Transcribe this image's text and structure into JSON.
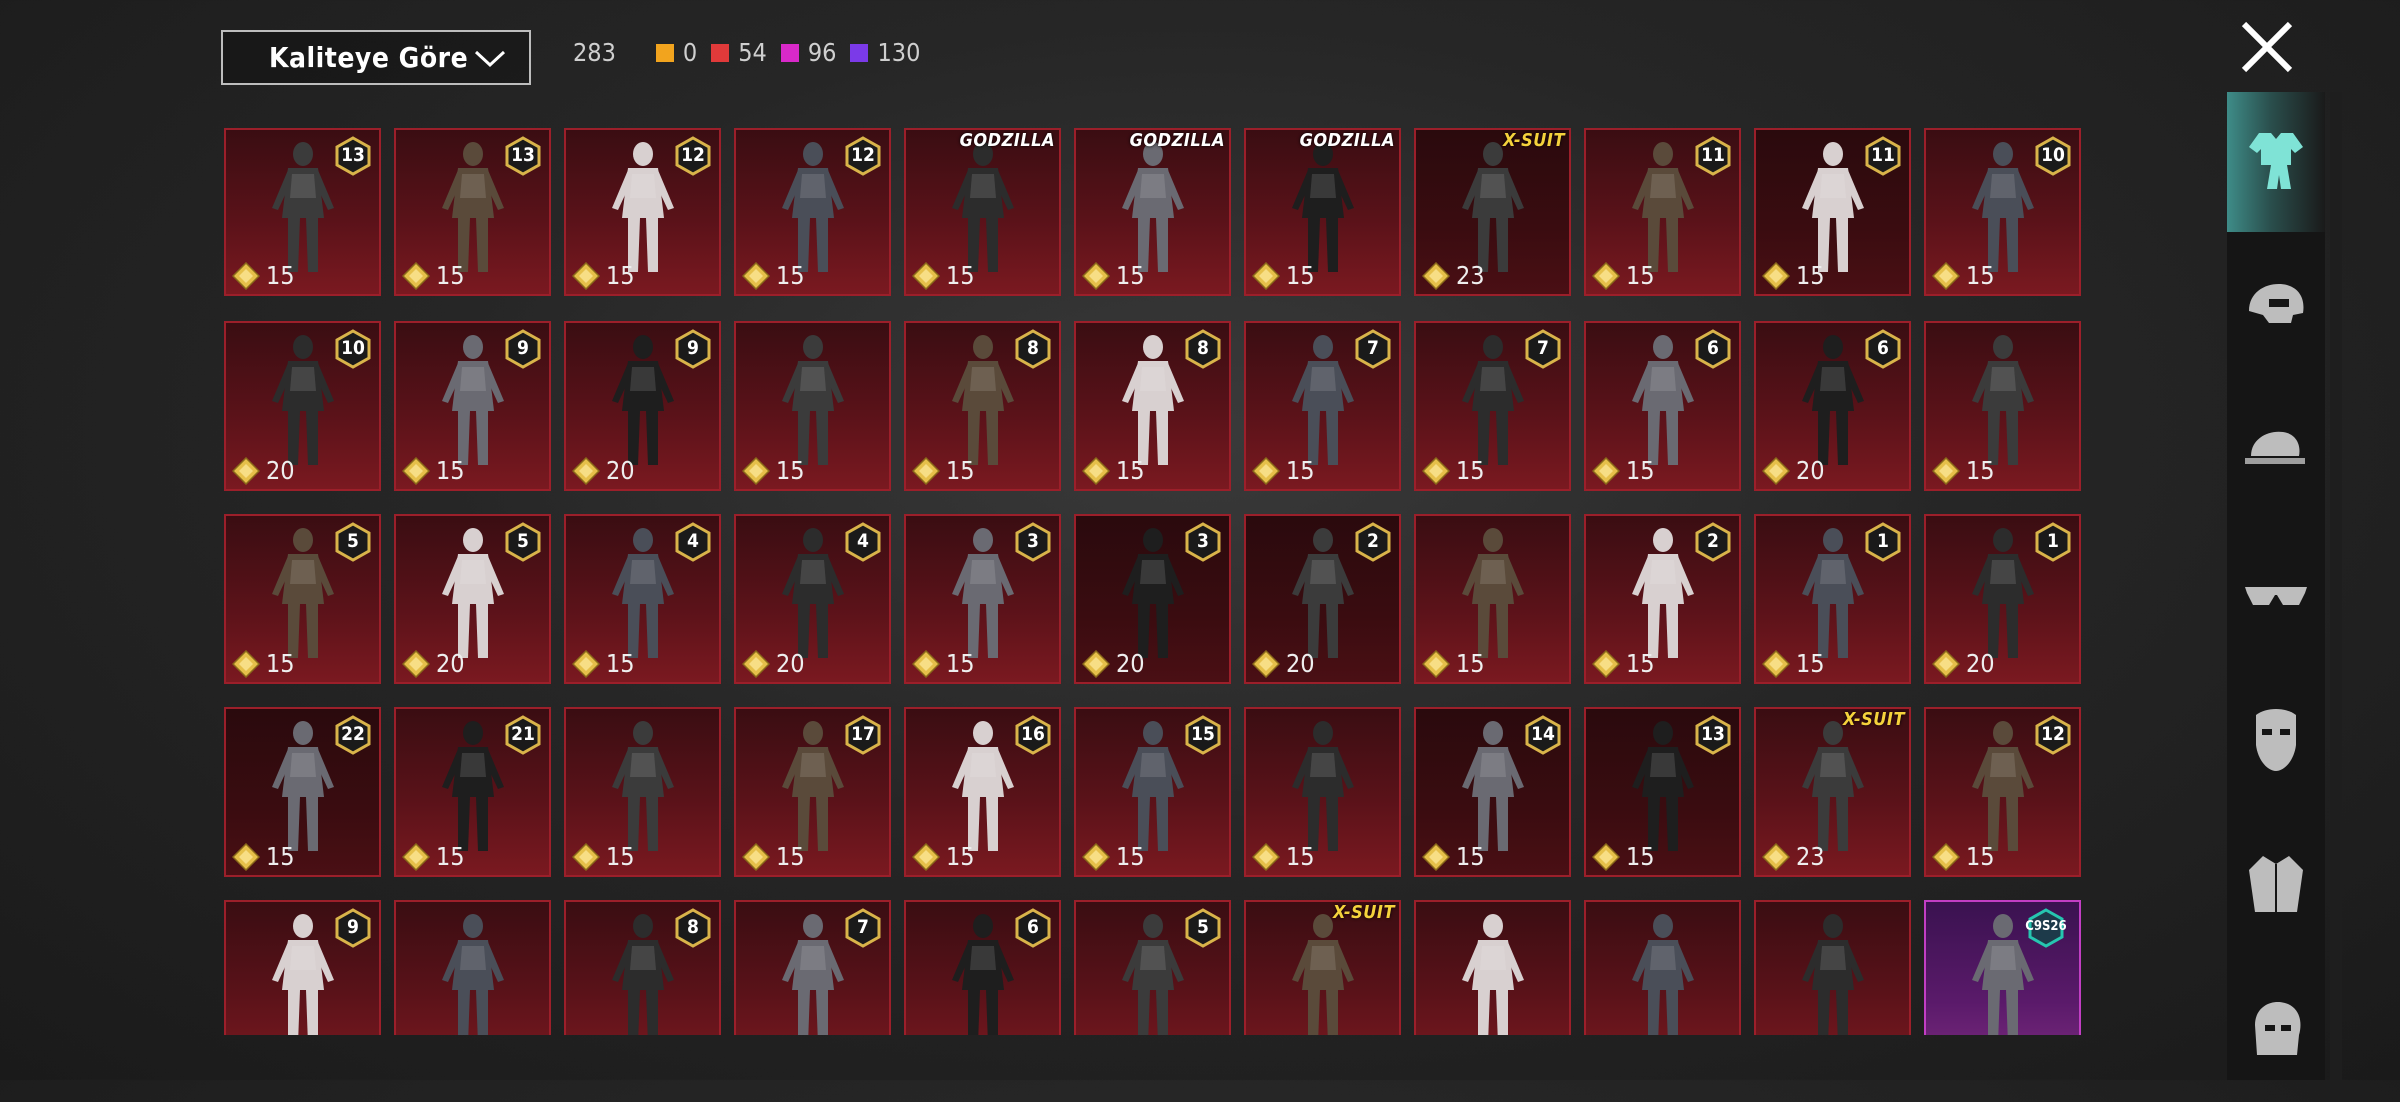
{
  "toolbar": {
    "sort_label": "Kaliteye Göre",
    "total": "283",
    "counts": [
      {
        "value": "0",
        "color": "#f2a41e"
      },
      {
        "value": "54",
        "color": "#e03a3a"
      },
      {
        "value": "96",
        "color": "#d929c9"
      },
      {
        "value": "130",
        "color": "#7b3ae8"
      }
    ]
  },
  "sidebar": {
    "categories": [
      {
        "icon": "outfit-icon",
        "active": true
      },
      {
        "icon": "helmet-icon",
        "active": false
      },
      {
        "icon": "cap-icon",
        "active": false
      },
      {
        "icon": "glasses-icon",
        "active": false
      },
      {
        "icon": "mask-icon",
        "active": false
      },
      {
        "icon": "jacket-icon",
        "active": false
      },
      {
        "icon": "head-icon",
        "active": false
      }
    ]
  },
  "items": [
    {
      "badge": "13",
      "price": "15"
    },
    {
      "badge": "13",
      "price": "15"
    },
    {
      "badge": "12",
      "price": "15"
    },
    {
      "badge": "12",
      "price": "15"
    },
    {
      "tag": "GODZILLA",
      "price": "15"
    },
    {
      "tag": "GODZILLA",
      "price": "15"
    },
    {
      "tag": "GODZILLA",
      "price": "15"
    },
    {
      "tag": "X-SUIT",
      "price": "23",
      "dim": true
    },
    {
      "badge": "11",
      "price": "15"
    },
    {
      "badge": "11",
      "price": "15",
      "dim": true
    },
    {
      "badge": "10",
      "price": "15"
    },
    {
      "badge": "10",
      "price": "20"
    },
    {
      "badge": "9",
      "price": "15"
    },
    {
      "badge": "9",
      "price": "20"
    },
    {
      "price": "15"
    },
    {
      "badge": "8",
      "price": "15"
    },
    {
      "badge": "8",
      "price": "15"
    },
    {
      "badge": "7",
      "price": "15"
    },
    {
      "badge": "7",
      "price": "15"
    },
    {
      "badge": "6",
      "price": "15"
    },
    {
      "badge": "6",
      "price": "20"
    },
    {
      "price": "15"
    },
    {
      "badge": "5",
      "price": "15"
    },
    {
      "badge": "5",
      "price": "20"
    },
    {
      "badge": "4",
      "price": "15"
    },
    {
      "badge": "4",
      "price": "20"
    },
    {
      "badge": "3",
      "price": "15"
    },
    {
      "badge": "3",
      "price": "20",
      "dim": true
    },
    {
      "badge": "2",
      "price": "20",
      "dim": true
    },
    {
      "price": "15"
    },
    {
      "badge": "2",
      "price": "15"
    },
    {
      "badge": "1",
      "price": "15"
    },
    {
      "badge": "1",
      "price": "20"
    },
    {
      "badge": "22",
      "price": "15",
      "dim": true
    },
    {
      "badge": "21",
      "price": "15"
    },
    {
      "price": "15"
    },
    {
      "badge": "17",
      "price": "15"
    },
    {
      "badge": "16",
      "price": "15"
    },
    {
      "badge": "15",
      "price": "15"
    },
    {
      "price": "15"
    },
    {
      "badge": "14",
      "price": "15",
      "dim": true
    },
    {
      "badge": "13",
      "price": "15",
      "dim": true
    },
    {
      "tag": "X-SUIT",
      "price": "23"
    },
    {
      "badge": "12",
      "price": "15"
    },
    {
      "badge": "9"
    },
    {},
    {
      "badge": "8"
    },
    {
      "badge": "7"
    },
    {
      "badge": "6"
    },
    {
      "badge": "5"
    },
    {
      "tag": "X-SUIT"
    },
    {},
    {},
    {},
    {
      "badge": "C9S26",
      "mythic": true
    }
  ]
}
